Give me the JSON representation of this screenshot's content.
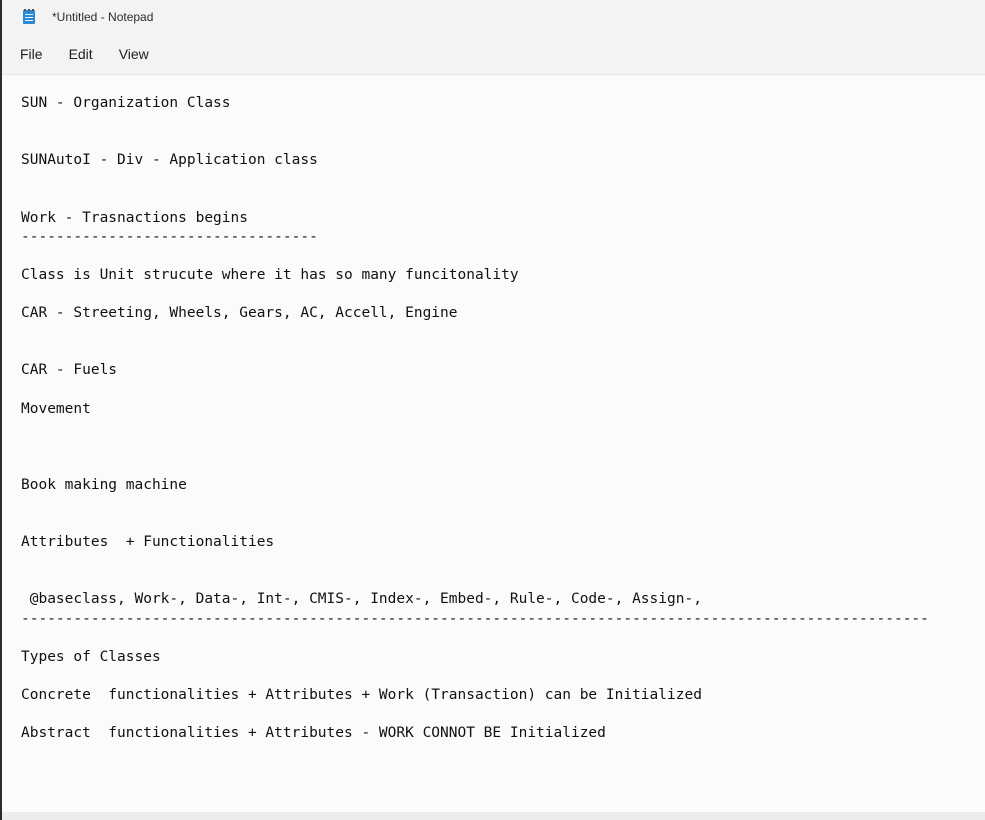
{
  "window": {
    "title": "*Untitled - Notepad",
    "icon": "notepad-icon"
  },
  "menu": {
    "items": [
      "File",
      "Edit",
      "View"
    ]
  },
  "editor": {
    "lines": [
      "SUN - Organization Class",
      "",
      "",
      "SUNAutoI - Div - Application class",
      "",
      "",
      "Work - Trasnactions begins",
      "----------------------------------",
      "",
      "Class is Unit strucute where it has so many funcitonality",
      "",
      "CAR - Streeting, Wheels, Gears, AC, Accell, Engine",
      "",
      "",
      "CAR - Fuels",
      "",
      "Movement",
      "",
      "",
      "",
      "Book making machine",
      "",
      "",
      "Attributes  + Functionalities",
      "",
      "",
      " @baseclass, Work-, Data-, Int-, CMIS-, Index-, Embed-, Rule-, Code-, Assign-,",
      "--------------------------------------------------------------------------------------------------------",
      "",
      "Types of Classes",
      "",
      "Concrete  functionalities + Attributes + Work (Transaction) can be Initialized",
      "",
      "Abstract  functionalities + Attributes - WORK CONNOT BE Initialized"
    ]
  }
}
